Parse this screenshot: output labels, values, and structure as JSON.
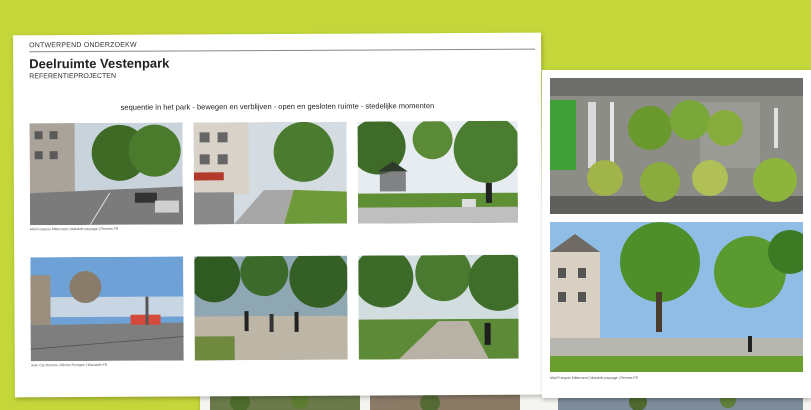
{
  "document": {
    "kicker": "ONTWERPEND ONDERZOEKW",
    "title": "Deelruimte Vestenpark",
    "subtitle": "REFERENTIEPROJECTEN",
    "sequence_caption": "sequentie in het park - bewegen en verblijven - open en gesloten ruimte - stedelijke momenten"
  },
  "credits": {
    "row1": "Mail François Mitterrand | Malabile paysage | Rennes FR",
    "row2": "Jean Cip Rennes | Michel Perrigan | Marseille FR",
    "side": "Mail François Mitterrand | Malabile paysage | Rennes FR"
  },
  "colors": {
    "background": "#c3d63a",
    "sheet": "#ffffff",
    "text": "#222222"
  }
}
